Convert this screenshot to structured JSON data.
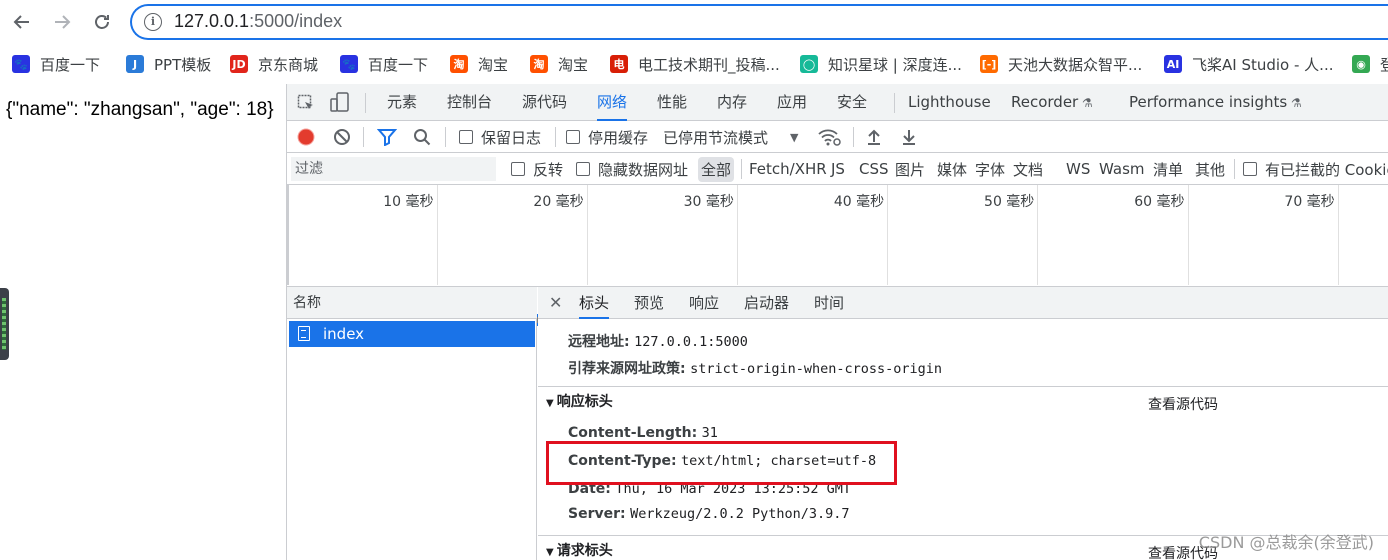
{
  "browser": {
    "url_host": "127.0.0.1",
    "url_rest": ":5000/index",
    "accent": "#1a73e8"
  },
  "bookmarks": [
    {
      "label": "百度一下",
      "icon": "baidu-icon",
      "color": "#2932e1",
      "glyph": "🐾"
    },
    {
      "label": "PPT模板",
      "icon": "ppt-icon",
      "color": "#2b7bd8",
      "glyph": "J"
    },
    {
      "label": "京东商城",
      "icon": "jd-icon",
      "color": "#e1251b",
      "glyph": "JD"
    },
    {
      "label": "百度一下",
      "icon": "baidu-icon",
      "color": "#2932e1",
      "glyph": "🐾"
    },
    {
      "label": "淘宝",
      "icon": "taobao-icon",
      "color": "#ff5000",
      "glyph": "淘"
    },
    {
      "label": "淘宝",
      "icon": "taobao-icon",
      "color": "#ff5000",
      "glyph": "淘"
    },
    {
      "label": "电工技术期刊_投稿...",
      "icon": "journal-icon",
      "color": "#d81e06",
      "glyph": "电"
    },
    {
      "label": "知识星球 | 深度连...",
      "icon": "zsxq-icon",
      "color": "#16b998",
      "glyph": "◯"
    },
    {
      "label": "天池大数据众智平...",
      "icon": "tianchi-icon",
      "color": "#ff6a00",
      "glyph": "[-]"
    },
    {
      "label": "飞桨AI Studio - 人...",
      "icon": "paddle-icon",
      "color": "#2932e1",
      "glyph": "AI"
    },
    {
      "label": "登",
      "icon": "chrome-icon",
      "color": "#34a853",
      "glyph": "◉"
    }
  ],
  "page": {
    "json_text": "{\"name\": \"zhangsan\", \"age\": 18}"
  },
  "devtools": {
    "tabs": [
      "元素",
      "控制台",
      "源代码",
      "网络",
      "性能",
      "内存",
      "应用",
      "安全",
      "Lighthouse",
      "Recorder",
      "Performance insights"
    ],
    "active_tab": "网络",
    "toolbar": {
      "preserve_log": "保留日志",
      "disable_cache": "停用缓存",
      "throttling": "已停用节流模式"
    },
    "filter": {
      "placeholder": "过滤",
      "invert": "反转",
      "hide_data_urls": "隐藏数据网址",
      "types": [
        "全部",
        "Fetch/XHR",
        "JS",
        "CSS",
        "图片",
        "媒体",
        "字体",
        "文档",
        "WS",
        "Wasm",
        "清单",
        "其他"
      ],
      "blocked_cookies": "有已拦截的 Cookie"
    },
    "timeline": {
      "ticks": [
        "10 毫秒",
        "20 毫秒",
        "30 毫秒",
        "40 毫秒",
        "50 毫秒",
        "60 毫秒",
        "70 毫秒"
      ]
    },
    "requests": {
      "header": "名称",
      "items": [
        "index"
      ]
    },
    "detail": {
      "tabs": [
        "标头",
        "预览",
        "响应",
        "启动器",
        "时间"
      ],
      "active_tab": "标头",
      "general": [
        {
          "key": "远程地址:",
          "value": "127.0.0.1:5000"
        },
        {
          "key": "引荐来源网址政策:",
          "value": "strict-origin-when-cross-origin"
        }
      ],
      "response_title": "响应标头",
      "view_source": "查看源代码",
      "response_headers": [
        {
          "key": "Content-Length:",
          "value": "31"
        },
        {
          "key": "Content-Type:",
          "value": "text/html; charset=utf-8"
        },
        {
          "key": "Date:",
          "value": "Thu, 16 Mar 2023 13:25:52 GMT"
        },
        {
          "key": "Server:",
          "value": "Werkzeug/2.0.2 Python/3.9.7"
        }
      ],
      "request_title": "请求标头",
      "highlight_color": "#e0101f"
    }
  },
  "watermark": "CSDN @总裁余(余登武)"
}
